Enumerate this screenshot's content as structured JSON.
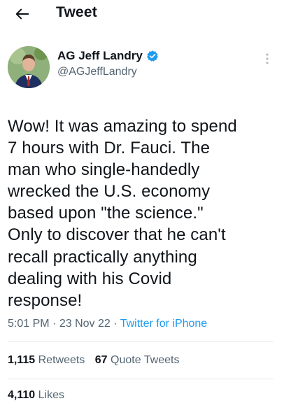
{
  "header": {
    "back_icon": "back-arrow-icon",
    "title": "Tweet"
  },
  "tweet": {
    "author": {
      "display_name": "AG Jeff Landry",
      "handle": "@AGJeffLandry",
      "verified": true,
      "verified_color": "#1d9bf0",
      "avatar_icon": "profile-photo"
    },
    "more_icon": "more-vertical-icon",
    "text": "Wow! It was amazing to spend\n7 hours with Dr. Fauci. The\nman who single-handedly\nwrecked the U.S. economy\nbased upon \"the science.\"\nOnly to discover that he can't\nrecall practically anything\ndealing with his Covid\nresponse!",
    "time": "5:01 PM",
    "date": "23 Nov 22",
    "separator": "·",
    "source": "Twitter for iPhone",
    "retweets": {
      "count": "1,115",
      "label": "Retweets"
    },
    "quote_tweets": {
      "count": "67",
      "label": "Quote Tweets"
    },
    "likes": {
      "count": "4,110",
      "label": "Likes"
    }
  },
  "colors": {
    "text": "#0f1419",
    "secondary": "#536471",
    "link": "#1d9bf0",
    "divider": "#e2e6ea"
  }
}
